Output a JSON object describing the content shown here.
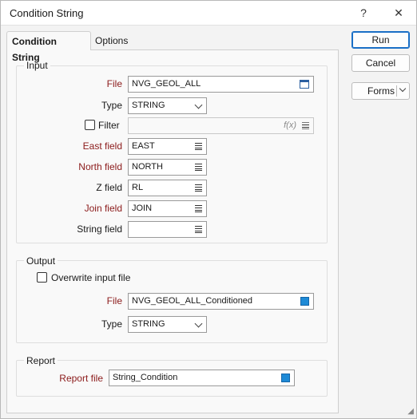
{
  "window": {
    "title": "Condition String",
    "help_symbol": "?",
    "close_symbol": "✕"
  },
  "tabs": [
    {
      "label": "Condition String"
    },
    {
      "label": "Options"
    }
  ],
  "buttons": {
    "run": "Run",
    "cancel": "Cancel",
    "forms": "Forms"
  },
  "input": {
    "title": "Input",
    "file_label": "File",
    "file_value": "NVG_GEOL_ALL",
    "type_label": "Type",
    "type_value": "STRING",
    "filter_label": "Filter",
    "filter_value": "",
    "filter_icon_text": "f(x)",
    "east_label": "East field",
    "east_value": "EAST",
    "north_label": "North field",
    "north_value": "NORTH",
    "z_label": "Z field",
    "z_value": "RL",
    "join_label": "Join field",
    "join_value": "JOIN",
    "string_label": "String field",
    "string_value": ""
  },
  "output": {
    "title": "Output",
    "overwrite_label": "Overwrite input file",
    "file_label": "File",
    "file_value": "NVG_GEOL_ALL_Conditioned",
    "type_label": "Type",
    "type_value": "STRING"
  },
  "report": {
    "title": "Report",
    "file_label": "Report file",
    "file_value": "String_Condition"
  },
  "colors": {
    "required_label": "#8b1a1a",
    "accent": "#1a6fc6",
    "file_picker": "#1e8ad6"
  }
}
